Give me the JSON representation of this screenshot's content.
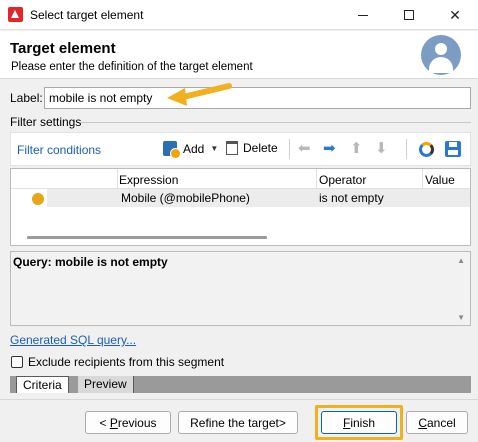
{
  "window": {
    "title": "Select target element"
  },
  "header": {
    "title": "Target element",
    "subtitle": "Please enter the definition of the target element"
  },
  "label_field": {
    "label": "Label:",
    "value": "mobile is not empty"
  },
  "filter_settings": {
    "section_label": "Filter settings",
    "link": "Filter conditions",
    "toolbar": {
      "add": "Add",
      "delete": "Delete"
    }
  },
  "grid": {
    "columns": [
      "Expression",
      "Operator",
      "Value"
    ],
    "rows": [
      {
        "expression": "Mobile (@mobilePhone)",
        "operator": "is not empty",
        "value": ""
      }
    ]
  },
  "query": {
    "text": "Query: mobile is not empty"
  },
  "sql_link": "Generated SQL query...",
  "exclude_checkbox": {
    "label": "Exclude recipients from this segment",
    "checked": false
  },
  "tabs": [
    "Criteria",
    "Preview"
  ],
  "buttons": {
    "previous_prefix": "< ",
    "previous_key": "P",
    "previous_rest": "revious",
    "refine": "Refine the target>",
    "finish_key": "F",
    "finish_rest": "inish",
    "cancel_key": "C",
    "cancel_rest": "ancel"
  },
  "colors": {
    "accent": "#1a5fb4",
    "highlight": "#f0b020",
    "status_dot": "#e8a317"
  }
}
